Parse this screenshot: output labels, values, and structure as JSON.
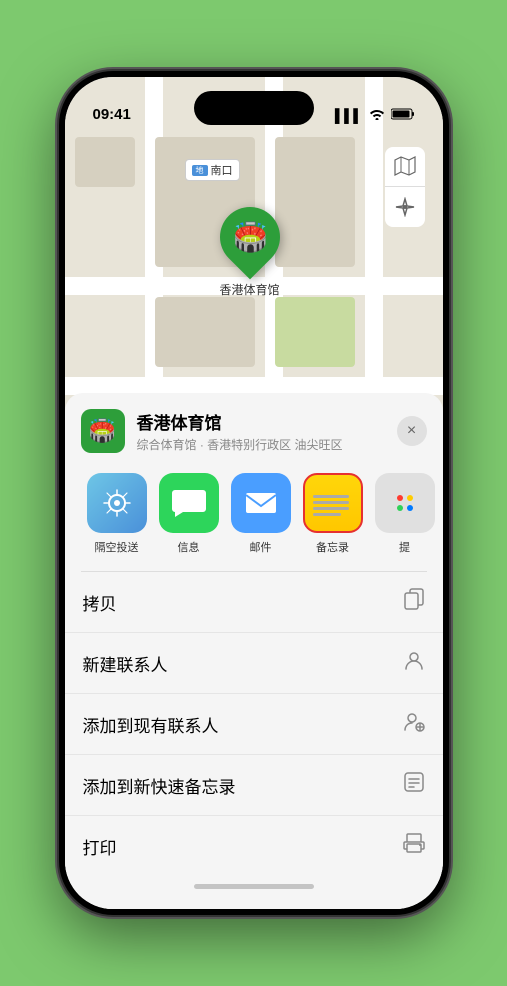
{
  "status_bar": {
    "time": "09:41",
    "signal": "▌▌▌",
    "wifi": "WiFi",
    "battery": "🔋"
  },
  "map": {
    "label": "南口",
    "pin_label": "香港体育馆"
  },
  "sheet": {
    "venue_name": "香港体育馆",
    "venue_sub": "综合体育馆 · 香港特别行政区 油尖旺区",
    "close_label": "×"
  },
  "share_items": [
    {
      "id": "airdrop",
      "label": "隔空投送",
      "emoji": "📡"
    },
    {
      "id": "messages",
      "label": "信息",
      "emoji": "💬"
    },
    {
      "id": "mail",
      "label": "邮件",
      "emoji": "✉️"
    },
    {
      "id": "notes",
      "label": "备忘录",
      "emoji": ""
    },
    {
      "id": "more",
      "label": "提",
      "emoji": ""
    }
  ],
  "actions": [
    {
      "label": "拷贝",
      "icon": "copy"
    },
    {
      "label": "新建联系人",
      "icon": "person"
    },
    {
      "label": "添加到现有联系人",
      "icon": "person-add"
    },
    {
      "label": "添加到新快速备忘录",
      "icon": "note"
    },
    {
      "label": "打印",
      "icon": "print"
    }
  ]
}
